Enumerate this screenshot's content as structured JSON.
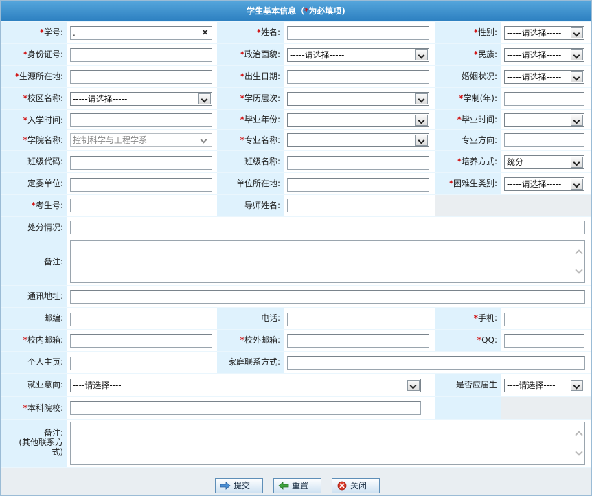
{
  "title": {
    "prefix": "学生基本信息（",
    "star": "*",
    "suffix": "为必填项)"
  },
  "fields": {
    "student_id": {
      "label": "学号:",
      "value": ".",
      "clear": "×"
    },
    "name": {
      "label": "姓名:"
    },
    "gender": {
      "label": "性别:",
      "value": "-----请选择-----"
    },
    "id_card": {
      "label": "身份证号:"
    },
    "political_status": {
      "label": "政治面貌:",
      "value": "-----请选择-----"
    },
    "ethnicity": {
      "label": "民族:",
      "value": "-----请选择-----"
    },
    "origin": {
      "label": "生源所在地:"
    },
    "birth_date": {
      "label": "出生日期:"
    },
    "marital_status": {
      "label": "婚姻状况:",
      "value": "-----请选择-----"
    },
    "campus": {
      "label": "校区名称:",
      "value": "-----请选择-----"
    },
    "degree_level": {
      "label": "学历层次:",
      "value": ""
    },
    "duration": {
      "label": "学制(年):"
    },
    "entry_date": {
      "label": "入学时间:"
    },
    "grad_year": {
      "label": "毕业年份:",
      "value": ""
    },
    "grad_date": {
      "label": "毕业时间:",
      "value": ""
    },
    "college": {
      "label": "学院名称:",
      "value": "控制科学与工程学系"
    },
    "major": {
      "label": "专业名称:",
      "value": ""
    },
    "major_direction": {
      "label": "专业方向:"
    },
    "class_code": {
      "label": "班级代码:"
    },
    "class_name": {
      "label": "班级名称:"
    },
    "training_mode": {
      "label": "培养方式:",
      "value": "统分"
    },
    "commissioned_unit": {
      "label": "定委单位:"
    },
    "unit_location": {
      "label": "单位所在地:"
    },
    "hardship_type": {
      "label": "困难生类别:",
      "value": "-----请选择-----"
    },
    "exam_no": {
      "label": "考生号:"
    },
    "supervisor": {
      "label": "导师姓名:"
    },
    "discipline": {
      "label": "处分情况:"
    },
    "remarks": {
      "label": "备注:"
    },
    "address": {
      "label": "通讯地址:"
    },
    "postcode": {
      "label": "邮编:"
    },
    "phone": {
      "label": "电话:"
    },
    "mobile": {
      "label": "手机:"
    },
    "campus_email": {
      "label": "校内邮箱:"
    },
    "external_email": {
      "label": "校外邮箱:"
    },
    "qq": {
      "label": "QQ:"
    },
    "homepage": {
      "label": "个人主页:"
    },
    "family_contact": {
      "label": "家庭联系方式:"
    },
    "employment_intent": {
      "label": "就业意向:",
      "value": "----请选择----"
    },
    "fresh_graduate": {
      "label": "是否应届生",
      "value": "----请选择----"
    },
    "undergrad_school": {
      "label": "本科院校:"
    },
    "other_contact_remarks": {
      "label_line1": "备注:",
      "label_line2": "(其他联系方",
      "label_line3": "式)"
    }
  },
  "buttons": {
    "submit": "提交",
    "reset": "重置",
    "close": "关闭"
  },
  "colors": {
    "title_bg": "#3a8fd0",
    "label_bg": "#dff2fd",
    "required": "#d01010"
  }
}
